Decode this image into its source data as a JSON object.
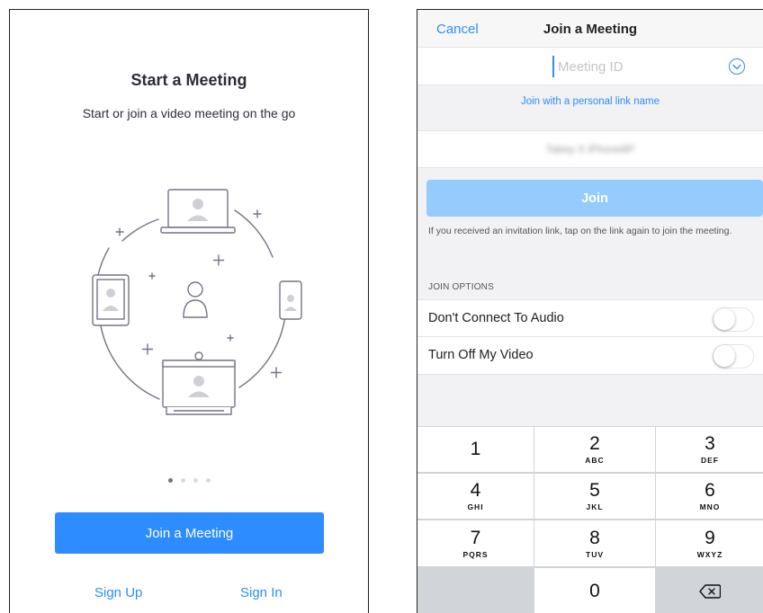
{
  "left_panel": {
    "title": "Start a Meeting",
    "subtitle": "Start or join a video meeting on the go",
    "page_indicator": {
      "total": 4,
      "active": 1
    },
    "join_button": "Join a Meeting",
    "sign_up": "Sign Up",
    "sign_in": "Sign In"
  },
  "right_panel": {
    "nav": {
      "cancel": "Cancel",
      "title": "Join a Meeting"
    },
    "meeting_id_placeholder": "Meeting ID",
    "personal_link": "Join with a personal link name",
    "display_name": "Tabey X iPhone8P",
    "join_button": "Join",
    "hint": "If you received an invitation link, tap on the link again to join the meeting.",
    "join_options_header": "JOIN OPTIONS",
    "options": [
      {
        "label": "Don't Connect To Audio",
        "enabled": false
      },
      {
        "label": "Turn Off My Video",
        "enabled": false
      }
    ],
    "keypad": [
      {
        "digit": "1",
        "letters": ""
      },
      {
        "digit": "2",
        "letters": "ABC"
      },
      {
        "digit": "3",
        "letters": "DEF"
      },
      {
        "digit": "4",
        "letters": "GHI"
      },
      {
        "digit": "5",
        "letters": "JKL"
      },
      {
        "digit": "6",
        "letters": "MNO"
      },
      {
        "digit": "7",
        "letters": "PQRS"
      },
      {
        "digit": "8",
        "letters": "TUV"
      },
      {
        "digit": "9",
        "letters": "WXYZ"
      },
      {
        "digit": "0",
        "letters": ""
      }
    ]
  },
  "colors": {
    "accent": "#2d8cff",
    "join_disabled": "#94cdfd",
    "keypad_bg": "#d1d4d9",
    "illustration_stroke": "#747487"
  }
}
